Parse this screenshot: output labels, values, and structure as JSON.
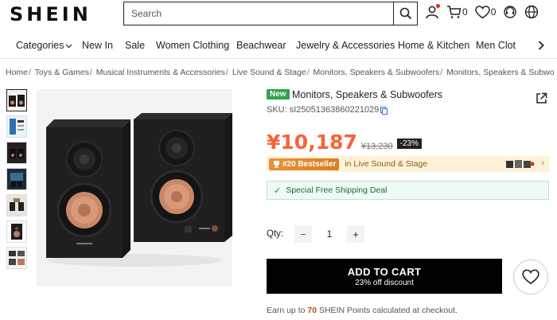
{
  "header": {
    "logo": "SHEIN",
    "search_placeholder": "Search",
    "cart_count": "0",
    "wishlist_count": "0"
  },
  "nav": {
    "items": [
      "Categories",
      "New In",
      "Sale",
      "Women Clothing",
      "Beachwear",
      "Jewelry & Accessories",
      "Home & Kitchen",
      "Men Clot"
    ]
  },
  "breadcrumb": [
    "Home",
    "Toys & Games",
    "Musical Instruments & Accessories",
    "Live Sound & Stage",
    "Monitors, Speakers & Subwoofers",
    "Monitors, Speakers & Subwoofe"
  ],
  "product": {
    "badge": "New",
    "title": "Monitors, Speakers & Subwoofers",
    "sku": "SKU: sI25051363860221029",
    "price": "¥10,187",
    "original_price": "¥13,230",
    "discount": "-23%",
    "bestseller_badge": "#20 Bestseller",
    "bestseller_text": "in Live Sound & Stage",
    "shipping": "Special Free Shipping Deal",
    "qty_label": "Qty:",
    "qty_value": "1",
    "qty_minus": "−",
    "qty_plus": "+",
    "add_to_cart": "ADD TO CART",
    "add_to_cart_sub": "23% off discount",
    "points_pre": "Earn up to ",
    "points_num": "70",
    "points_post": " SHEIN Points calculated at checkout."
  },
  "colors": {
    "price": "#fa6338",
    "new_badge": "#30a24a",
    "bestseller_bg": "#fdf1d8",
    "shipping_bg": "#eefaf3"
  },
  "icons": [
    "search-icon",
    "user-icon",
    "cart-icon",
    "heart-icon",
    "headset-icon",
    "globe-icon",
    "share-icon",
    "check-icon"
  ]
}
